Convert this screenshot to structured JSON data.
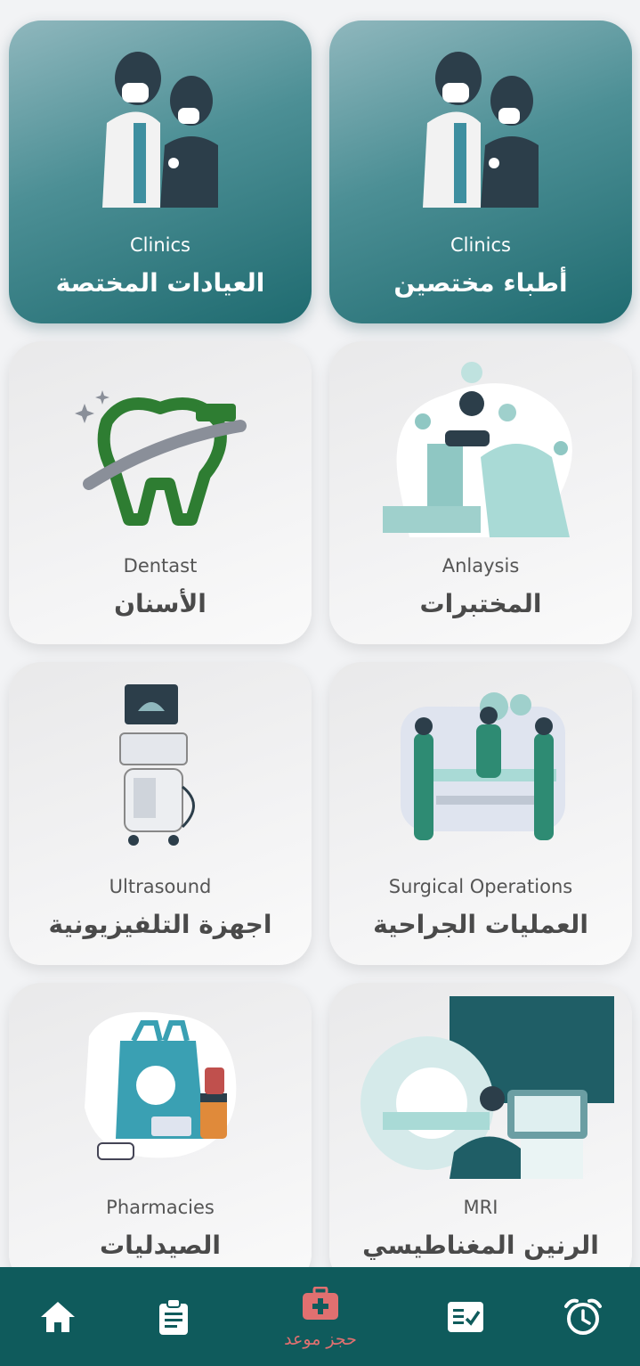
{
  "cards": [
    {
      "en": "Clinics",
      "ar": "أطباء مختصين",
      "icon": "doctor-patient-icon",
      "style": "teal"
    },
    {
      "en": "Clinics",
      "ar": "العيادات المختصة",
      "icon": "doctor-patient-icon",
      "style": "teal"
    },
    {
      "en": "Anlaysis",
      "ar": "المختبرات",
      "icon": "microscope-lab-icon",
      "style": "light"
    },
    {
      "en": "Dentast",
      "ar": "الأسنان",
      "icon": "tooth-toothbrush-icon",
      "style": "light"
    },
    {
      "en": "Surgical Operations",
      "ar": "العمليات الجراحية",
      "icon": "surgery-team-icon",
      "style": "light"
    },
    {
      "en": "Ultrasound",
      "ar": "اجهزة التلفيزيونية",
      "icon": "ultrasound-machine-icon",
      "style": "light"
    },
    {
      "en": "MRI",
      "ar": "الرنين المغناطيسي",
      "icon": "mri-scanner-icon",
      "style": "light"
    },
    {
      "en": "Pharmacies",
      "ar": "الصيدليات",
      "icon": "pharmacy-bag-icon",
      "style": "light"
    }
  ],
  "nav": {
    "book_label": "حجز موعد",
    "items": [
      "home-icon",
      "clipboard-icon",
      "medical-kit-icon",
      "checklist-icon",
      "alarm-clock-icon"
    ],
    "bg_color": "#0f5b5c",
    "active_color": "#e07070"
  }
}
